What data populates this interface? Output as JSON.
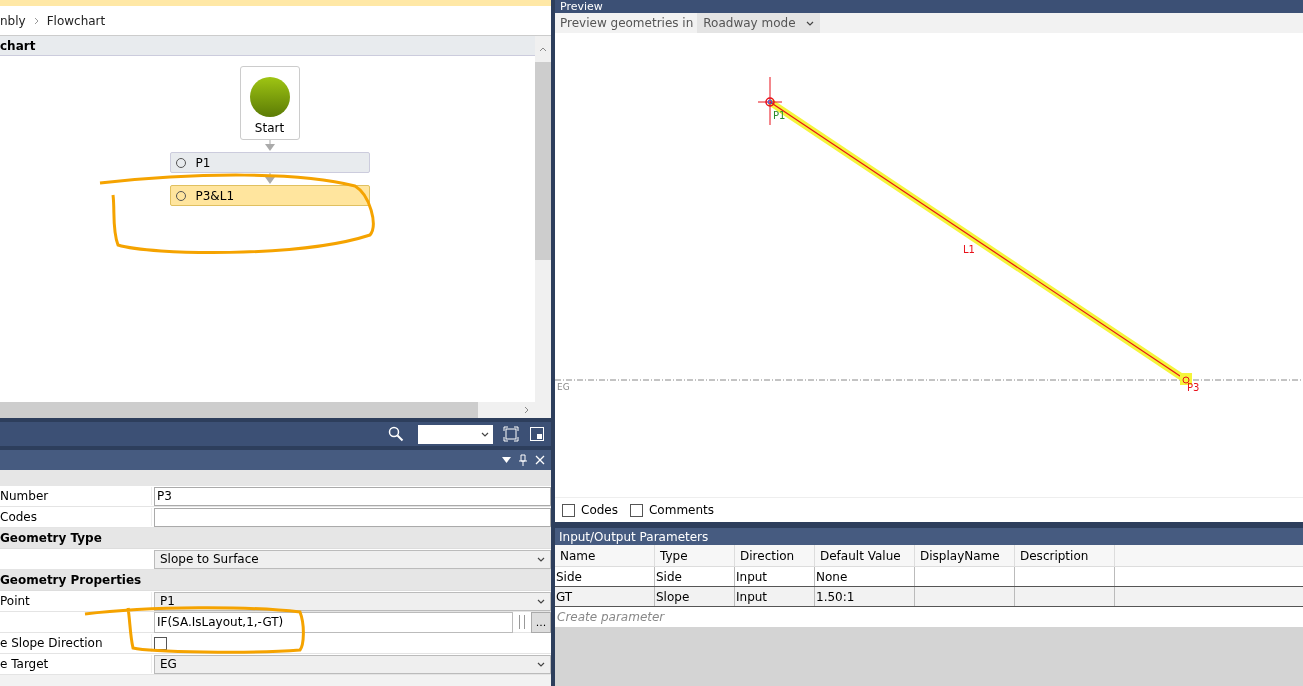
{
  "breadcrumb": [
    "nbly",
    "Flowchart"
  ],
  "flowchart": {
    "title": "chart",
    "start_label": "Start",
    "nodes": [
      {
        "label": "P1",
        "selected": false
      },
      {
        "label": "P3&L1",
        "selected": true
      }
    ]
  },
  "properties": {
    "rows": [
      {
        "kind": "field",
        "label": "Number",
        "value": "P3"
      },
      {
        "kind": "field",
        "label": "Codes",
        "value": ""
      },
      {
        "kind": "group",
        "label": "Geometry Type"
      },
      {
        "kind": "select",
        "label": "",
        "value": "Slope to Surface"
      },
      {
        "kind": "group",
        "label": "Geometry Properties"
      },
      {
        "kind": "select",
        "label": "Point",
        "value": "P1"
      },
      {
        "kind": "expression",
        "label": "",
        "value": "IF(SA.IsLayout,1,-GT)",
        "button": "..."
      },
      {
        "kind": "checkbox",
        "label": "e Slope Direction",
        "checked": false
      },
      {
        "kind": "select",
        "label": "e Target",
        "value": "EG"
      }
    ]
  },
  "preview": {
    "title": "Preview",
    "mode_label": "Preview geometries in",
    "mode": "Roadway mode",
    "labels": {
      "start": "P1",
      "line": "L1",
      "end": "P3",
      "surface": "EG"
    },
    "options": [
      {
        "label": "Codes",
        "checked": false
      },
      {
        "label": "Comments",
        "checked": false
      }
    ]
  },
  "parameters": {
    "title": "Input/Output Parameters",
    "columns": [
      "Name",
      "Type",
      "Direction",
      "Default Value",
      "DisplayName",
      "Description"
    ],
    "rows": [
      [
        "Side",
        "Side",
        "Input",
        "None",
        "",
        ""
      ],
      [
        "GT",
        "Slope",
        "Input",
        "1.50:1",
        "",
        ""
      ]
    ],
    "placeholder": "Create parameter"
  }
}
